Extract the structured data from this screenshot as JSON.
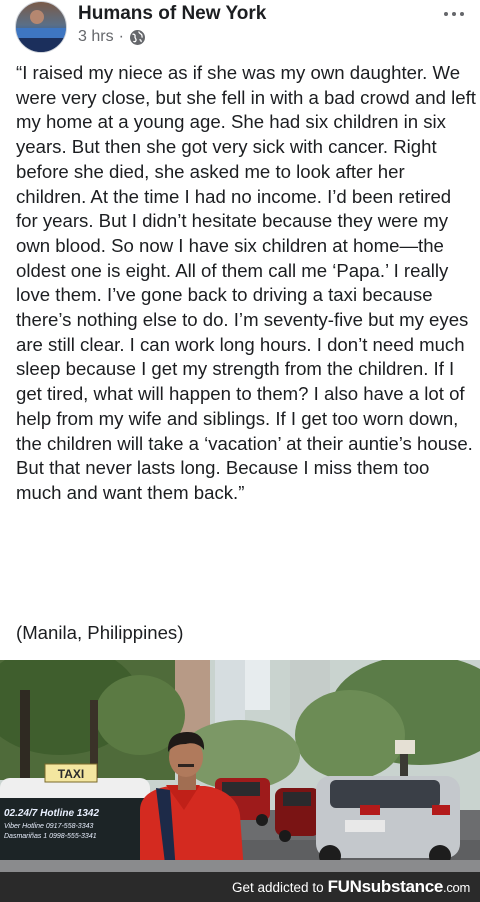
{
  "post": {
    "page_name": "Humans of New York",
    "timestamp": "3 hrs",
    "separator": "·",
    "privacy_icon": "globe-icon",
    "more_icon": "more-horizontal-icon",
    "body": "“I raised my niece as if she was my own daughter.  We were very close, but she fell in with a bad crowd and left my home at a young age.  She had six children in six years.  But then she got very sick with cancer.  Right before she died, she asked me to look after her children.  At the time I had no income.  I’d been retired for years.  But I didn’t hesitate because they were my own blood.  So now I have six children at home—the oldest one is eight.  All of them call me ‘Papa.’  I really love them.  I’ve gone back to driving a taxi because there’s nothing else to do.  I’m seventy-five but my eyes are still clear.  I can work long hours.  I don’t need much sleep because I get my strength from the children.  If I get tired, what will happen to them?  I also have a lot of help from my wife and siblings.  If I get too worn down, the children will take a ‘vacation’ at their auntie’s house.  But that never lasts long.  Because I miss them too much and want them back.”",
    "location": "(Manila, Philippines)"
  },
  "photo": {
    "taxi_sign": "TAXI",
    "taxi_hotline": "02.24/7 Hotline 1342",
    "taxi_line2": "Viber Hotline 0917-558-3343",
    "taxi_line3": "Dasmariñas 1  0998-555-3341"
  },
  "footer": {
    "tagline": "Get addicted to",
    "brand": "FUNsubstance",
    "brand_suffix": ".com"
  }
}
